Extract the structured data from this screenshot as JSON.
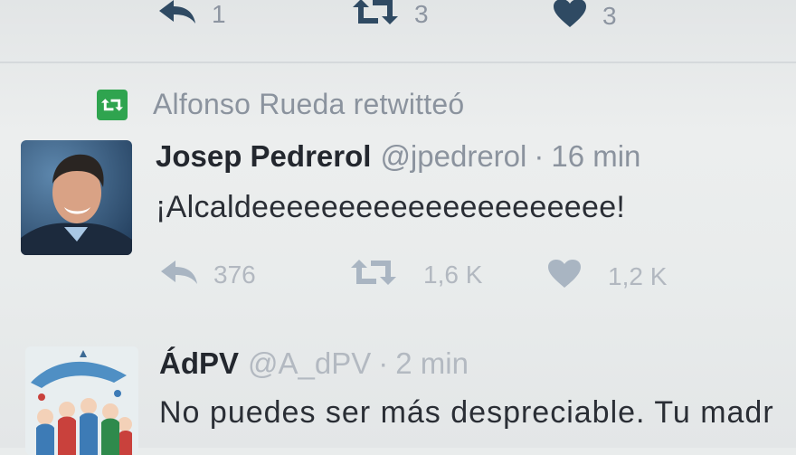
{
  "previous_tweet": {
    "actions": [
      {
        "icon": "reply-icon",
        "count": "1"
      },
      {
        "icon": "retweet-icon",
        "count": "3"
      },
      {
        "icon": "heart-icon",
        "count": "3"
      }
    ]
  },
  "retweet_context": {
    "icon": "retweet-icon",
    "text": "Alfonso Rueda retwitteó",
    "badge_color": "#2fa44f"
  },
  "tweet1": {
    "name": "Josep Pedrerol",
    "handle": "@jpedrerol",
    "separator": "·",
    "time": "16 min",
    "text": "¡Alcaldeeeeeeeeeeeeeeeeeeeee!",
    "actions": [
      {
        "icon": "reply-icon",
        "count": "376"
      },
      {
        "icon": "retweet-icon",
        "count": "1,6 K"
      },
      {
        "icon": "heart-icon",
        "count": "1,2 K"
      }
    ]
  },
  "tweet2": {
    "name": "ÁdPV",
    "handle": "@A_dPV",
    "separator": "·",
    "time": "2 min",
    "text": "No puedes ser más despreciable. Tu madr"
  },
  "colors": {
    "muted_text": "#8b939e",
    "faded_icon": "#b2b8c0",
    "dark_icon": "#2f4a63"
  }
}
